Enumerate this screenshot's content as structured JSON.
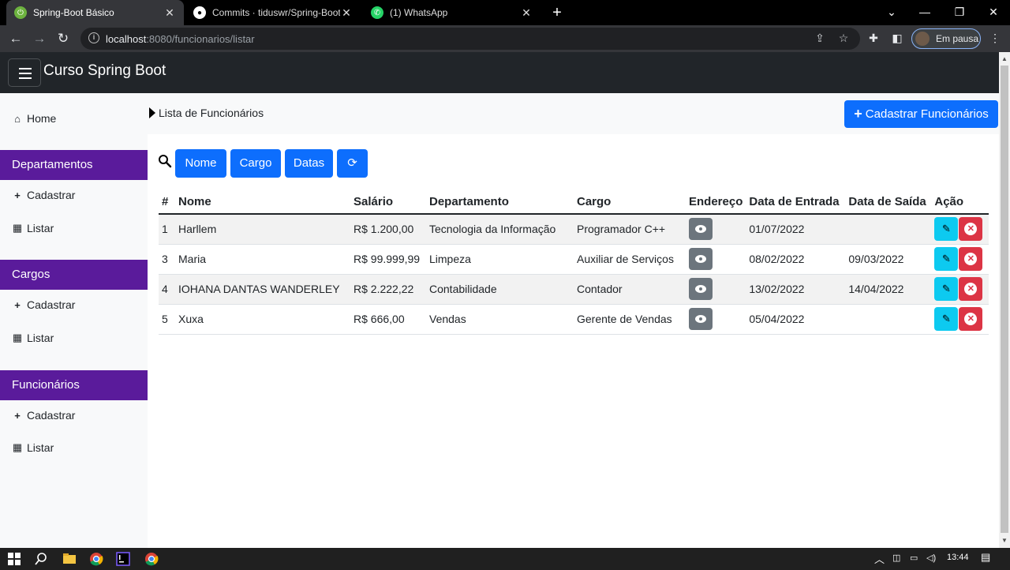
{
  "browser": {
    "tabs": [
      {
        "title": "Spring-Boot Básico",
        "active": true
      },
      {
        "title": "Commits · tiduswr/Spring-Boot_",
        "active": false
      },
      {
        "title": "(1) WhatsApp",
        "active": false
      }
    ],
    "url_host": "localhost",
    "url_path": ":8080/funcionarios/listar",
    "profile_label": "Em pausa"
  },
  "app": {
    "brand": "Curso Spring Boot"
  },
  "sidebar": {
    "home": "Home",
    "sections": [
      {
        "title": "Departamentos",
        "add": "Cadastrar",
        "list": "Listar"
      },
      {
        "title": "Cargos",
        "add": "Cadastrar",
        "list": "Listar"
      },
      {
        "title": "Funcionários",
        "add": "Cadastrar",
        "list": "Listar"
      }
    ]
  },
  "main": {
    "breadcrumb": "Lista de Funcionários",
    "add_button": "Cadastrar Funcionários",
    "filters": [
      "Nome",
      "Cargo",
      "Datas"
    ],
    "table": {
      "headers": [
        "#",
        "Nome",
        "Salário",
        "Departamento",
        "Cargo",
        "Endereço",
        "Data de Entrada",
        "Data de Saída",
        "Ação"
      ],
      "rows": [
        {
          "id": "1",
          "nome": "Harllem",
          "salario": "R$ 1.200,00",
          "departamento": "Tecnologia da Informação",
          "cargo": "Programador C++",
          "entrada": "01/07/2022",
          "saida": ""
        },
        {
          "id": "3",
          "nome": "Maria",
          "salario": "R$ 99.999,99",
          "departamento": "Limpeza",
          "cargo": "Auxiliar de Serviços",
          "entrada": "08/02/2022",
          "saida": "09/03/2022"
        },
        {
          "id": "4",
          "nome": "IOHANA DANTAS WANDERLEY",
          "salario": "R$ 2.222,22",
          "departamento": "Contabilidade",
          "cargo": "Contador",
          "entrada": "13/02/2022",
          "saida": "14/04/2022"
        },
        {
          "id": "5",
          "nome": "Xuxa",
          "salario": "R$ 666,00",
          "departamento": "Vendas",
          "cargo": "Gerente de Vendas",
          "entrada": "05/04/2022",
          "saida": ""
        }
      ]
    }
  },
  "taskbar": {
    "clock": "13:44"
  },
  "colors": {
    "primary": "#0d6efd",
    "sidebar_header": "#5a1b9b",
    "navbar": "#212529",
    "info": "#0dcaf0",
    "danger": "#dc3545",
    "secondary": "#6c757d"
  }
}
